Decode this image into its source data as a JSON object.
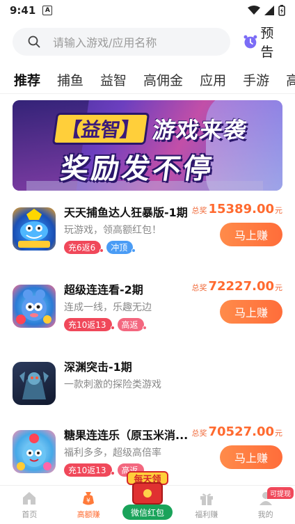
{
  "status_bar": {
    "time": "9:41",
    "indicator": "A"
  },
  "search": {
    "placeholder": "请输入游戏/应用名称"
  },
  "preview": {
    "label": "预告"
  },
  "tabs": [
    {
      "label": "推荐",
      "active": true
    },
    {
      "label": "捕鱼"
    },
    {
      "label": "益智"
    },
    {
      "label": "高佣金"
    },
    {
      "label": "应用"
    },
    {
      "label": "手游"
    },
    {
      "label": "高"
    }
  ],
  "banner": {
    "tag": "【益智】",
    "line1": "游戏来袭",
    "line2": "奖励发不停"
  },
  "games": [
    {
      "title": "天天捕鱼达人狂暴版-1期",
      "desc": "玩游戏，领高额红包！",
      "tags": [
        {
          "text": "充6返6",
          "color": "red"
        },
        {
          "text": "冲顶",
          "color": "blue"
        }
      ],
      "prize_label": "总奖",
      "prize_value": "15389.00",
      "prize_unit": "元",
      "button": "马上赚"
    },
    {
      "title": "超级连连看-2期",
      "desc": "连成一线，乐趣无边",
      "tags": [
        {
          "text": "充10返13",
          "color": "red"
        },
        {
          "text": "高返",
          "color": "pink"
        }
      ],
      "prize_label": "总奖",
      "prize_value": "72227.00",
      "prize_unit": "元",
      "button": "马上赚"
    },
    {
      "title": "深渊突击-1期",
      "desc": "一款刺激的探险类游戏",
      "tags": []
    },
    {
      "title": "糖果连连乐（原玉米消...",
      "desc": "福利多多，超级高倍率",
      "tags": [
        {
          "text": "充10返13",
          "color": "red"
        },
        {
          "text": "高返",
          "color": "pink"
        }
      ],
      "prize_label": "总奖",
      "prize_value": "70527.00",
      "prize_unit": "元",
      "button": "马上赚"
    }
  ],
  "bottom_nav": [
    {
      "label": "首页",
      "icon": "home-icon"
    },
    {
      "label": "高额赚",
      "icon": "money-bag-icon",
      "active": true
    },
    {
      "label": "微信红包",
      "day_tag": "每天领",
      "icon": "red-envelope-icon"
    },
    {
      "label": "福利赚",
      "icon": "gift-icon"
    },
    {
      "label": "我的",
      "icon": "user-icon",
      "badge": "可提现"
    }
  ],
  "colors": {
    "accent": "#ff6a2f",
    "tag_red": "#f0485a",
    "tag_blue": "#4a9cf5",
    "wechat_green": "#1aa35a"
  }
}
